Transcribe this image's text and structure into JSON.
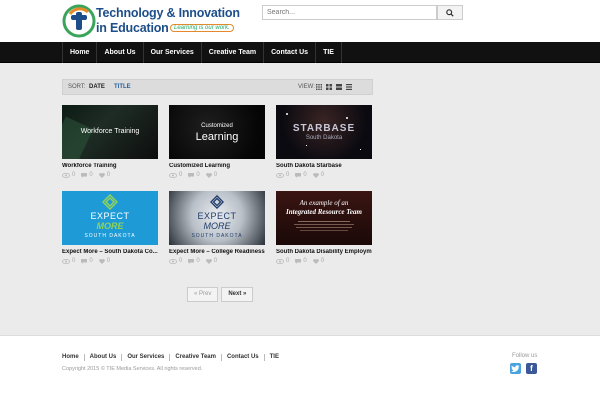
{
  "header": {
    "logo_line1": "Technology & Innovation",
    "logo_line2": "in Education",
    "logo_tagline": "Learning is our work.",
    "search": {
      "placeholder": "Search...",
      "icon": "search-icon"
    }
  },
  "nav": {
    "items": [
      {
        "label": "Home"
      },
      {
        "label": "About Us"
      },
      {
        "label": "Our Services"
      },
      {
        "label": "Creative Team"
      },
      {
        "label": "Contact Us"
      },
      {
        "label": "TIE"
      }
    ]
  },
  "sortbar": {
    "sort_label": "SORT:",
    "sort_date": "DATE",
    "sort_title": "TITLE",
    "view_label": "VIEW:",
    "view_icons": [
      "grid-small-icon",
      "grid-medium-icon",
      "grid-large-icon",
      "list-icon"
    ]
  },
  "cards": [
    {
      "title": "Workforce Training",
      "thumb_text": "Workforce Training",
      "views": "0",
      "comments": "0",
      "likes": "0"
    },
    {
      "title": "Customized Learning",
      "thumb_text_1": "Customized",
      "thumb_text_2": "Learning",
      "views": "0",
      "comments": "0",
      "likes": "0"
    },
    {
      "title": "South Dakota Starbase",
      "thumb_text_1": "STARBASE",
      "thumb_text_2": "South Dakota",
      "views": "0",
      "comments": "0",
      "likes": "0"
    },
    {
      "title": "Expect More – South Dakota Co...",
      "thumb_text_1": "EXPECT",
      "thumb_text_2": "MORE",
      "thumb_text_3": "SOUTH DAKOTA",
      "views": "0",
      "comments": "0",
      "likes": "0"
    },
    {
      "title": "Expect More – College Readiness",
      "thumb_text_1": "EXPECT",
      "thumb_text_2": "MORE",
      "thumb_text_3": "SOUTH DAKOTA",
      "views": "0",
      "comments": "0",
      "likes": "0"
    },
    {
      "title": "South Dakota Disability Employm...",
      "thumb_text_1": "An example of an",
      "thumb_text_2": "Integrated Resource Team",
      "views": "0",
      "comments": "0",
      "likes": "0"
    }
  ],
  "pager": {
    "prev": "« Prev",
    "next": "Next »"
  },
  "footer": {
    "links": [
      {
        "label": "Home"
      },
      {
        "label": "About Us"
      },
      {
        "label": "Our Services"
      },
      {
        "label": "Creative Team"
      },
      {
        "label": "Contact Us"
      },
      {
        "label": "TIE"
      }
    ],
    "copyright": "Copyright 2015 © TIE Media Services. All rights reserved.",
    "follow_label": "Follow us",
    "social": [
      {
        "icon": "twitter-icon",
        "color": "#4aa3df"
      },
      {
        "icon": "facebook-icon",
        "color": "#3b5998"
      }
    ]
  },
  "colors": {
    "nav_bg": "#111111",
    "brand_blue": "#1d4e89",
    "expect_more_blue": "#1e9ad6",
    "link_blue": "#2a5e9c"
  }
}
